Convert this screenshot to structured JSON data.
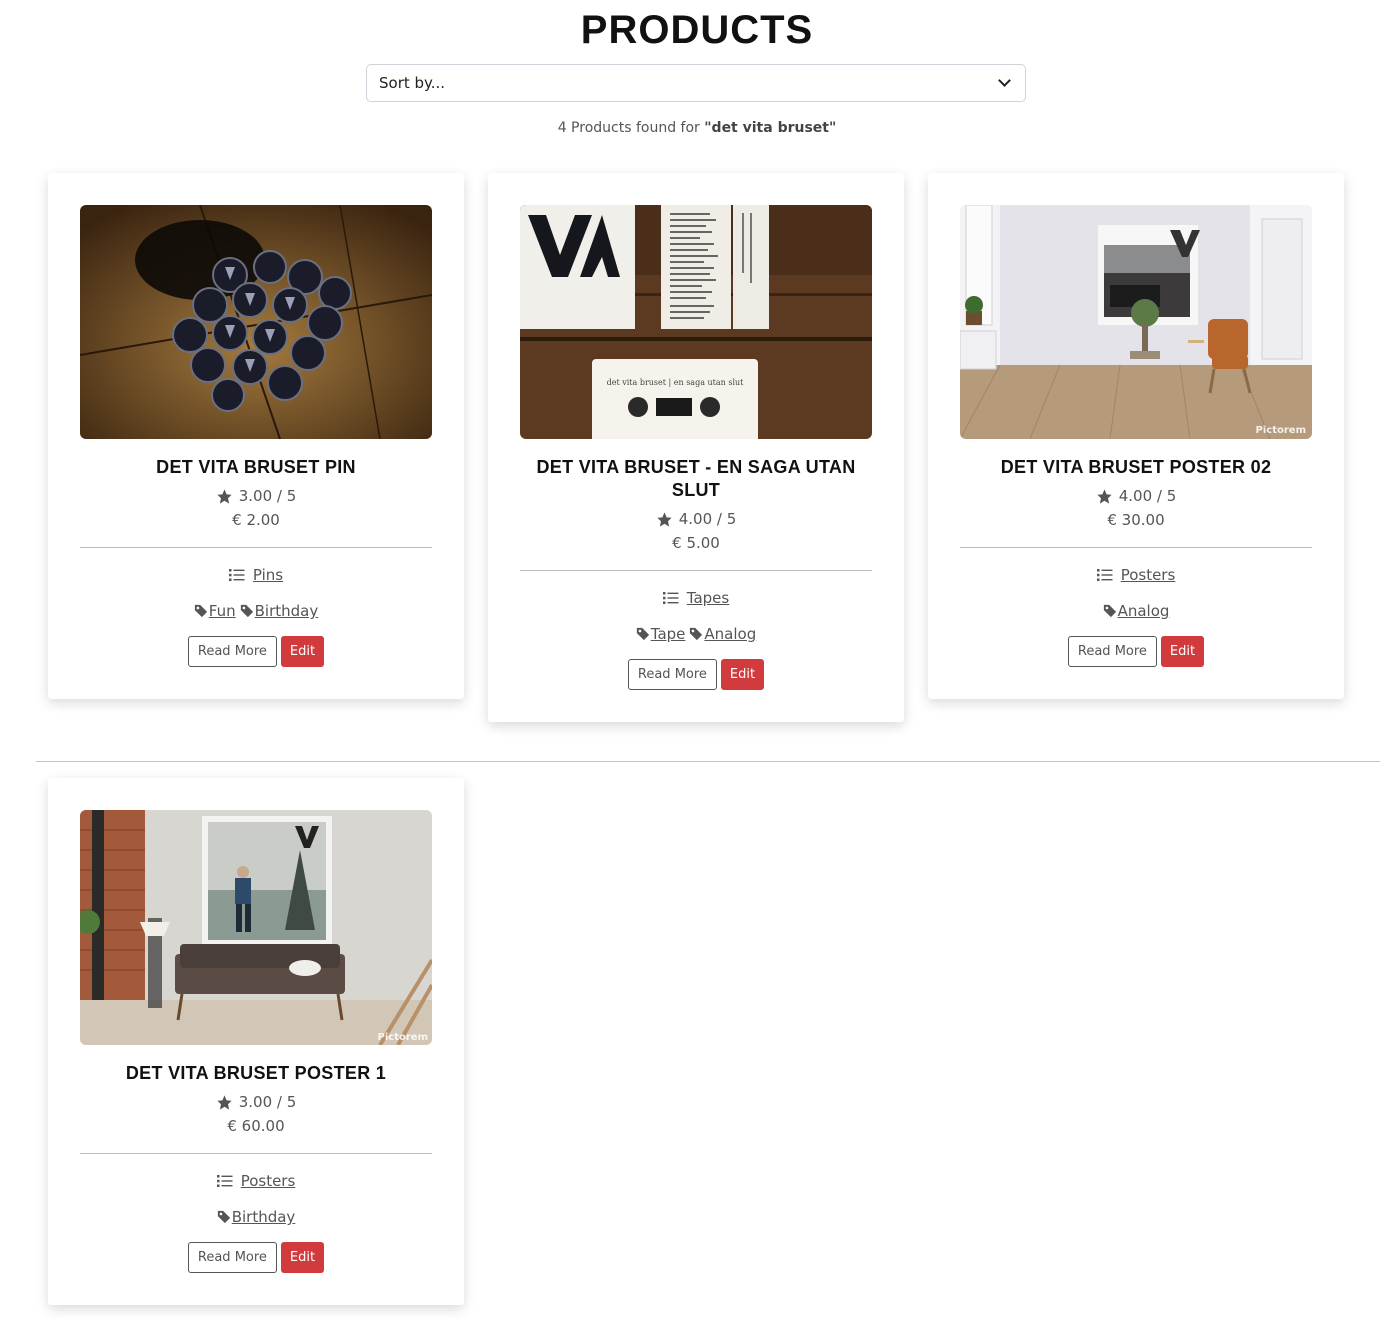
{
  "page": {
    "title": "PRODUCTS",
    "sort_placeholder": "Sort by...",
    "found_prefix": "4 Products found for ",
    "found_query": "\"det vita bruset\""
  },
  "products": [
    {
      "name": "DET VITA BRUSET PIN",
      "rating": "3.00 / 5",
      "price": "€ 2.00",
      "category": "Pins",
      "tags": [
        "Fun",
        "Birthday"
      ],
      "read_more": "Read More",
      "edit": "Edit"
    },
    {
      "name": "DET VITA BRUSET - EN SAGA UTAN SLUT",
      "rating": "4.00 / 5",
      "price": "€ 5.00",
      "category": "Tapes",
      "tags": [
        "Tape",
        "Analog"
      ],
      "read_more": "Read More",
      "edit": "Edit",
      "image_text": "det vita bruset | en saga utan slut"
    },
    {
      "name": "DET VITA BRUSET POSTER 02",
      "rating": "4.00 / 5",
      "price": "€ 30.00",
      "category": "Posters",
      "tags": [
        "Analog"
      ],
      "read_more": "Read More",
      "edit": "Edit",
      "image_text": "Pictorem"
    },
    {
      "name": "DET VITA BRUSET POSTER 1",
      "rating": "3.00 / 5",
      "price": "€ 60.00",
      "category": "Posters",
      "tags": [
        "Birthday"
      ],
      "read_more": "Read More",
      "edit": "Edit",
      "image_text": "Pictorem"
    }
  ],
  "colors": {
    "edit_button": "#d13b3e",
    "text_muted": "#555555"
  }
}
